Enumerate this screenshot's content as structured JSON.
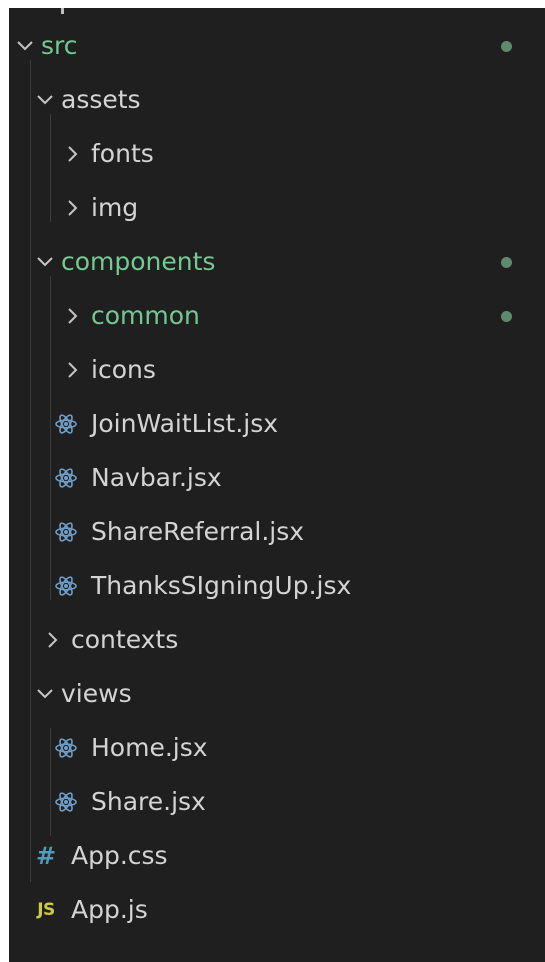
{
  "explorer": {
    "items": [
      {
        "label": "src",
        "kind": "folder",
        "expanded": true,
        "modified": true
      },
      {
        "label": "assets",
        "kind": "folder",
        "expanded": true,
        "modified": false
      },
      {
        "label": "fonts",
        "kind": "folder",
        "expanded": false,
        "modified": false
      },
      {
        "label": "img",
        "kind": "folder",
        "expanded": false,
        "modified": false
      },
      {
        "label": "components",
        "kind": "folder",
        "expanded": true,
        "modified": true
      },
      {
        "label": "common",
        "kind": "folder",
        "expanded": false,
        "modified": true
      },
      {
        "label": "icons",
        "kind": "folder",
        "expanded": false,
        "modified": false
      },
      {
        "label": "JoinWaitList.jsx",
        "kind": "file",
        "icon": "react-icon"
      },
      {
        "label": "Navbar.jsx",
        "kind": "file",
        "icon": "react-icon"
      },
      {
        "label": "ShareReferral.jsx",
        "kind": "file",
        "icon": "react-icon"
      },
      {
        "label": "ThanksSIgningUp.jsx",
        "kind": "file",
        "icon": "react-icon"
      },
      {
        "label": "contexts",
        "kind": "folder",
        "expanded": false,
        "modified": false
      },
      {
        "label": "views",
        "kind": "folder",
        "expanded": true,
        "modified": false
      },
      {
        "label": "Home.jsx",
        "kind": "file",
        "icon": "react-icon"
      },
      {
        "label": "Share.jsx",
        "kind": "file",
        "icon": "react-icon"
      },
      {
        "label": "App.css",
        "kind": "file",
        "icon": "css-icon",
        "icon_glyph": "#"
      },
      {
        "label": "App.js",
        "kind": "file",
        "icon": "js-icon",
        "icon_glyph": "JS"
      }
    ]
  },
  "colors": {
    "background": "#1f1f1f",
    "text": "#d4d4d4",
    "modified_text": "#73c991",
    "modified_dot": "#6a9f7e",
    "react_icon": "#6f9fc9",
    "css_icon": "#519aba",
    "js_icon": "#cbcb41"
  }
}
